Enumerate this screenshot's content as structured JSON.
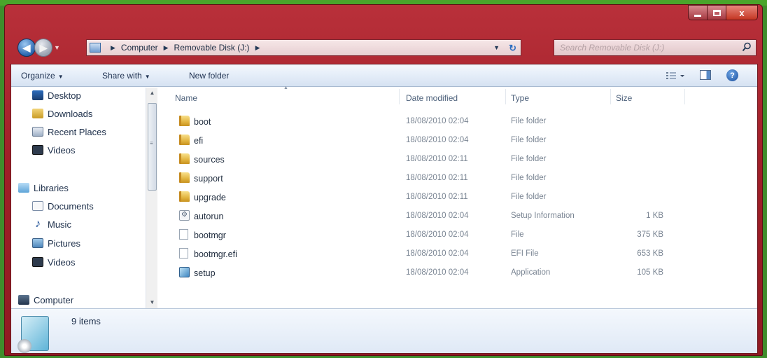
{
  "window": {
    "caption_close": "x"
  },
  "address": {
    "crumbs": [
      "Computer",
      "Removable Disk (J:)"
    ],
    "search_placeholder": "Search Removable Disk (J:)"
  },
  "toolbar": {
    "organize": "Organize",
    "share_with": "Share with",
    "new_folder": "New folder",
    "help": "?"
  },
  "nav_pane": {
    "items": [
      {
        "label": "Desktop",
        "icon": "desktop-icon"
      },
      {
        "label": "Downloads",
        "icon": "downloads-icon"
      },
      {
        "label": "Recent Places",
        "icon": "recent-places-icon"
      },
      {
        "label": "Videos",
        "icon": "videos-icon"
      },
      {
        "label": "Libraries",
        "icon": "libraries-icon"
      },
      {
        "label": "Documents",
        "icon": "documents-icon"
      },
      {
        "label": "Music",
        "icon": "music-icon"
      },
      {
        "label": "Pictures",
        "icon": "pictures-icon"
      },
      {
        "label": "Videos",
        "icon": "videos-icon"
      },
      {
        "label": "Computer",
        "icon": "computer-icon"
      }
    ]
  },
  "file_list": {
    "columns": {
      "name": "Name",
      "date": "Date modified",
      "type": "Type",
      "size": "Size"
    },
    "rows": [
      {
        "name": "boot",
        "date": "18/08/2010 02:04",
        "type": "File folder",
        "size": "",
        "icon": "folder-icon"
      },
      {
        "name": "efi",
        "date": "18/08/2010 02:04",
        "type": "File folder",
        "size": "",
        "icon": "folder-icon"
      },
      {
        "name": "sources",
        "date": "18/08/2010 02:11",
        "type": "File folder",
        "size": "",
        "icon": "folder-icon"
      },
      {
        "name": "support",
        "date": "18/08/2010 02:11",
        "type": "File folder",
        "size": "",
        "icon": "folder-icon"
      },
      {
        "name": "upgrade",
        "date": "18/08/2010 02:11",
        "type": "File folder",
        "size": "",
        "icon": "folder-icon"
      },
      {
        "name": "autorun",
        "date": "18/08/2010 02:04",
        "type": "Setup Information",
        "size": "1 KB",
        "icon": "setup-information-icon"
      },
      {
        "name": "bootmgr",
        "date": "18/08/2010 02:04",
        "type": "File",
        "size": "375 KB",
        "icon": "file-icon"
      },
      {
        "name": "bootmgr.efi",
        "date": "18/08/2010 02:04",
        "type": "EFI File",
        "size": "653 KB",
        "icon": "file-icon"
      },
      {
        "name": "setup",
        "date": "18/08/2010 02:04",
        "type": "Application",
        "size": "105 KB",
        "icon": "application-icon"
      }
    ]
  },
  "status_bar": {
    "item_count": "9 items"
  }
}
